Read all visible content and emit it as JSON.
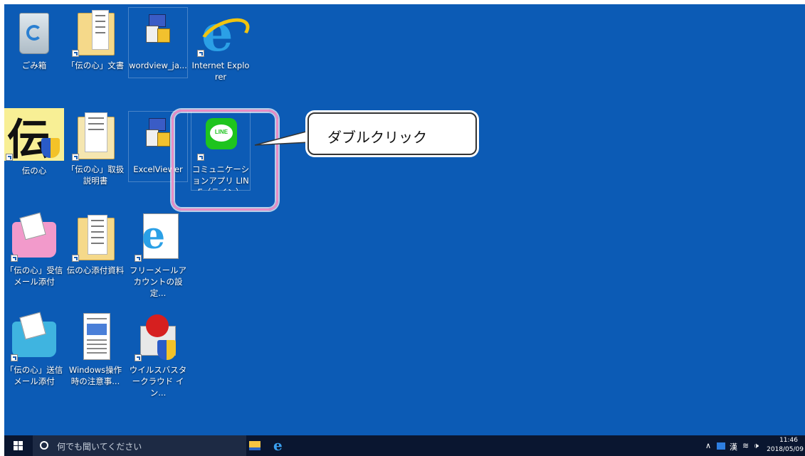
{
  "desktop": {
    "icons": [
      {
        "id": "recycle-bin",
        "label": "ごみ箱"
      },
      {
        "id": "denshin-docs",
        "label": "「伝の心」文書"
      },
      {
        "id": "wordview",
        "label": "wordview_ja..."
      },
      {
        "id": "ie",
        "label": "Internet Explorer"
      },
      {
        "id": "denshin",
        "label": "伝の心"
      },
      {
        "id": "denshin-manual",
        "label": "「伝の心」取扱説明書"
      },
      {
        "id": "excelviewer",
        "label": "ExcelViewer"
      },
      {
        "id": "line",
        "label": "コミュニケーションアプリ LINE（ライン）"
      },
      {
        "id": "received-attach",
        "label": "「伝の心」受信メール添付"
      },
      {
        "id": "attached-docs",
        "label": "伝の心添付資料"
      },
      {
        "id": "free-mail",
        "label": "フリーメールアカウントの設定..."
      },
      {
        "id": "sent-attach",
        "label": "「伝の心」送信メール添付"
      },
      {
        "id": "windows-notes",
        "label": "Windows操作時の注意事..."
      },
      {
        "id": "virusbuster",
        "label": "ウイルスバスタークラウド イン..."
      }
    ],
    "callout_text": "ダブルクリック",
    "line_badge": "LINE"
  },
  "taskbar": {
    "search_placeholder": "何でも聞いてください",
    "clock_time": "11:46",
    "clock_date": "2018/05/09",
    "tray_caret": "∧",
    "tray_ime": "漢",
    "tray_volume": "🕩"
  },
  "colors": {
    "desktop_bg": "#0c5bb5",
    "taskbar_bg": "#0a1630",
    "highlight": "#e88cc4",
    "line_green": "#1ec41e"
  }
}
